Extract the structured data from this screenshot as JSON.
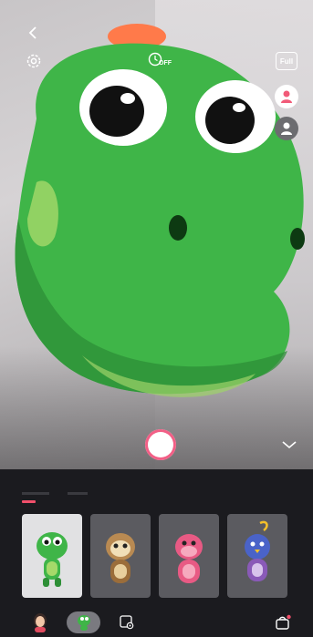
{
  "camera": {
    "timer_label": "OFF",
    "full_label": "Full"
  },
  "panel": {
    "tabs": [
      "",
      ""
    ],
    "cards": [
      {
        "name": "dinosaur",
        "selected": true
      },
      {
        "name": "sloth",
        "selected": false
      },
      {
        "name": "pink-creature",
        "selected": false
      },
      {
        "name": "blue-bird",
        "selected": false
      }
    ]
  },
  "colors": {
    "accent": "#f2506b",
    "shutter_ring": "#f25f86",
    "dino_green": "#3fb548"
  }
}
